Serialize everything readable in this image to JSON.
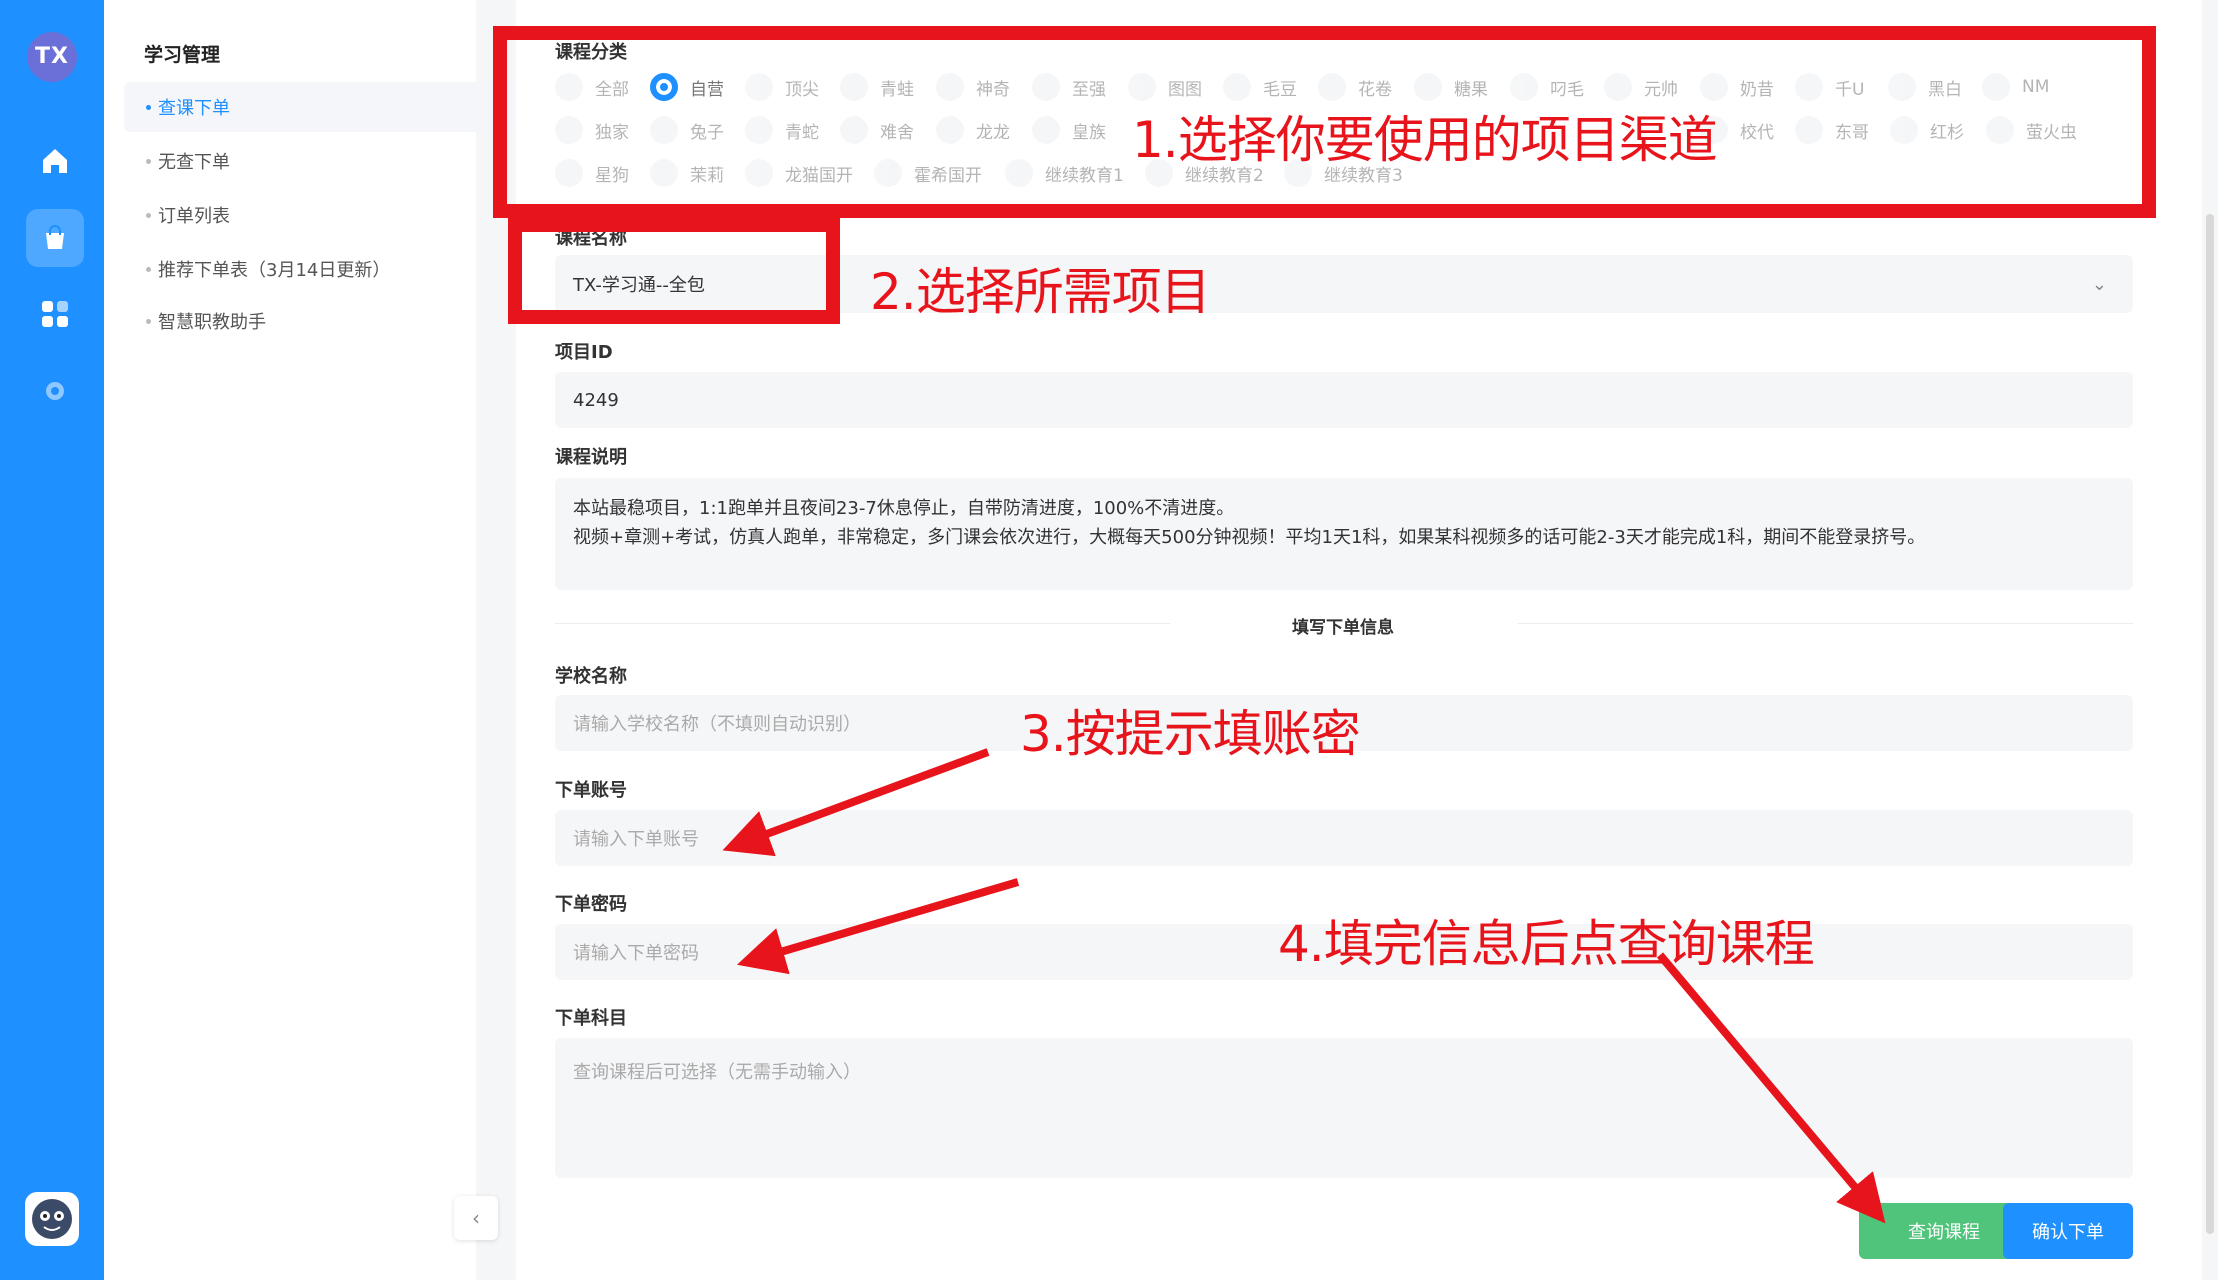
{
  "rail": {
    "logo": "TX",
    "icons": [
      "home-icon",
      "bag-icon",
      "apps-icon",
      "gear-icon"
    ]
  },
  "subnav": {
    "title": "学习管理",
    "items": [
      {
        "label": "查课下单",
        "active": true
      },
      {
        "label": "无查下单",
        "active": false
      },
      {
        "label": "订单列表",
        "active": false
      },
      {
        "label": "推荐下单表（3月14日更新）",
        "active": false
      },
      {
        "label": "智慧职教助手",
        "active": false
      }
    ]
  },
  "form": {
    "category_label": "课程分类",
    "categories_row1": [
      "全部",
      "自营",
      "顶尖",
      "青蛙",
      "神奇",
      "至强",
      "图图",
      "毛豆",
      "花卷",
      "糖果",
      "叼毛",
      "元帅",
      "奶昔",
      "千U",
      "黑白",
      "NM"
    ],
    "categories_row2": [
      "独家",
      "兔子",
      "青蛇",
      "难舍",
      "龙龙",
      "皇族",
      "校代",
      "东哥",
      "红杉",
      "萤火虫"
    ],
    "categories_row3": [
      "星狗",
      "茉莉",
      "龙猫国开",
      "霍希国开",
      "继续教育1",
      "继续教育2",
      "继续教育3"
    ],
    "selected_category": "自营",
    "course_name_label": "课程名称",
    "course_name_value": "TX-学习通--全包",
    "project_id_label": "项目ID",
    "project_id_value": "4249",
    "description_label": "课程说明",
    "description_value": "本站最稳项目，1:1跑单并且夜间23-7休息停止，自带防清进度，100%不清进度。\n视频+章测+考试，仿真人跑单，非常稳定，多门课会依次进行，大概每天500分钟视频！平均1天1科，如果某科视频多的话可能2-3天才能完成1科，期间不能登录挤号。",
    "section_title": "填写下单信息",
    "school_label": "学校名称",
    "school_placeholder": "请输入学校名称（不填则自动识别）",
    "account_label": "下单账号",
    "account_placeholder": "请输入下单账号",
    "password_label": "下单密码",
    "password_placeholder": "请输入下单密码",
    "subject_label": "下单科目",
    "subject_placeholder": "查询课程后可选择（无需手动输入）",
    "query_button": "查询课程",
    "confirm_button": "确认下单"
  },
  "annotations": {
    "step1": "1.选择你要使用的项目渠道",
    "step2": "2.选择所需项目",
    "step3": "3.按提示填账密",
    "step4": "4.填完信息后点查询课程",
    "color": "#e8141c"
  },
  "colors": {
    "primary": "#1e90ff",
    "success": "#4fc47a",
    "annotation": "#e8141c"
  }
}
